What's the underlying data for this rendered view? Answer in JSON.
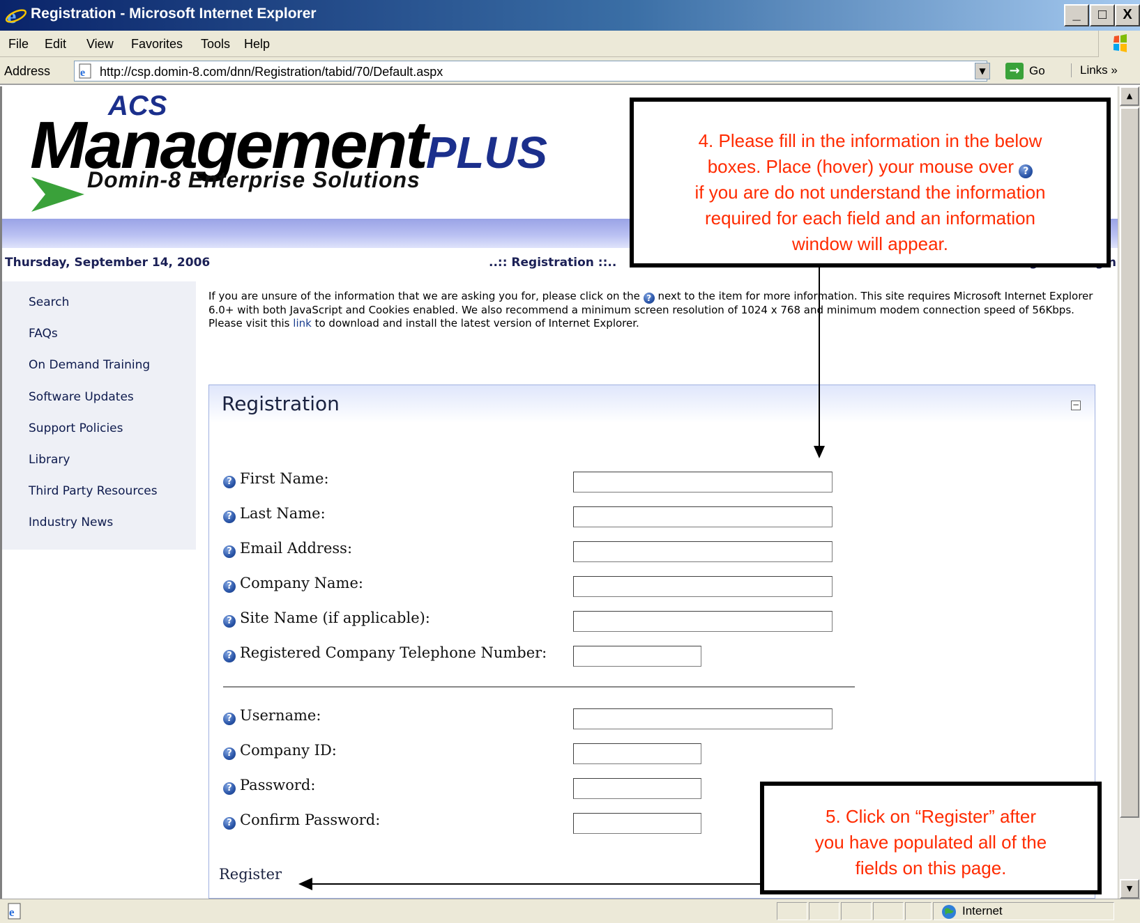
{
  "window": {
    "title": "Registration - Microsoft Internet Explorer",
    "controls": [
      "_",
      "□",
      "X"
    ]
  },
  "menu": [
    "File",
    "Edit",
    "View",
    "Favorites",
    "Tools",
    "Help"
  ],
  "address_bar": {
    "label": "Address",
    "url": "http://csp.domin-8.com/dnn/Registration/tabid/70/Default.aspx",
    "go_label": "Go",
    "links_label": "Links »"
  },
  "logo": {
    "acs": "ACS",
    "main": "Management",
    "plus": "PLUS",
    "tagline": "Domin-8 Enterprise Solutions"
  },
  "header_row": {
    "date": "Thursday, September 14, 2006",
    "breadcrumb": "..:: Registration ::..",
    "register": "Register",
    "login": "Login"
  },
  "sidebar": {
    "items": [
      "Search",
      "FAQs",
      "On Demand Training",
      "Software Updates",
      "Support Policies",
      "Library",
      "Third Party Resources",
      "Industry News"
    ]
  },
  "intro": {
    "part1": "If you are unsure of the information that we are asking you for, please click on the",
    "part2": "next to the item for more information. This site requires Microsoft Internet Explorer 6.0+ with both JavaScript and Cookies enabled. We also recommend a minimum screen resolution of 1024 x 768 and minimum modem connection speed of 56Kbps. Please visit this",
    "link": "link",
    "part3": "to download and install the latest version of Internet Explorer."
  },
  "form": {
    "title": "Registration",
    "collapse_glyph": "−",
    "fields": [
      "First Name:",
      "Last Name:",
      "Email Address:",
      "Company Name:",
      "Site Name (if applicable):",
      "Registered Company Telephone Number:",
      "Username:",
      "Company ID:",
      "Password:",
      "Confirm Password:"
    ],
    "values": [
      "",
      "",
      "",
      "",
      "",
      "",
      "",
      "",
      "",
      ""
    ],
    "register_label": "Register"
  },
  "callouts": {
    "step4_line1": "4.  Please fill in the information in the below",
    "step4_line2": "boxes.  Place (hover) your mouse over",
    "step4_line3": "if you are do not understand the information",
    "step4_line4": "required for each field and an information",
    "step4_line5": "window will appear.",
    "step5_line1": "5.  Click on “Register” after",
    "step5_line2": "you have populated all of the",
    "step5_line3": "fields on this page."
  },
  "status_bar": {
    "zone": "Internet"
  },
  "colors": {
    "callout_text": "#ff2b00",
    "title_bar": "#0a246a",
    "nav_text": "#0d1a4d"
  },
  "icons": [
    "ie-logo-icon",
    "page-icon",
    "go-arrow-icon",
    "help-question-icon",
    "collapse-icon",
    "globe-icon",
    "windows-logo-icon"
  ]
}
